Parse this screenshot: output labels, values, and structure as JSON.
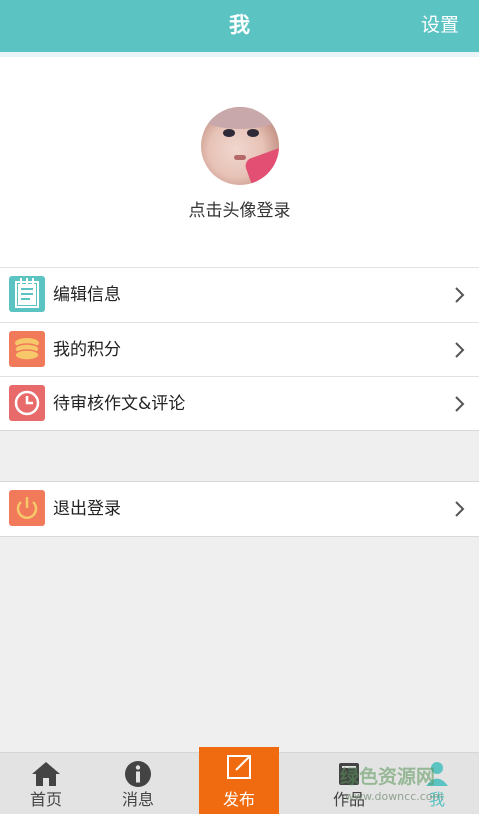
{
  "header": {
    "title": "我",
    "settings_label": "设置"
  },
  "profile": {
    "login_hint": "点击头像登录"
  },
  "menu": {
    "items": [
      {
        "label": "编辑信息",
        "icon": "edit-note-icon",
        "color": "#5cc3c3"
      },
      {
        "label": "我的积分",
        "icon": "coins-icon",
        "color": "#f07a5a"
      },
      {
        "label": "待审核作文&评论",
        "icon": "clock-icon",
        "color": "#e86a6a"
      }
    ],
    "logout": {
      "label": "退出登录",
      "icon": "power-icon",
      "color": "#f07a5a"
    }
  },
  "tabbar": {
    "tabs": [
      {
        "label": "首页",
        "icon": "home-icon"
      },
      {
        "label": "消息",
        "icon": "info-icon"
      },
      {
        "label": "发布",
        "icon": "compose-icon",
        "active_color": "#f06a0f"
      },
      {
        "label": "作品",
        "icon": "book-icon"
      },
      {
        "label": "我",
        "icon": "user-icon",
        "selected": true
      }
    ]
  },
  "watermark": {
    "text": "绿色资源网",
    "url": "www.downcc.com"
  },
  "colors": {
    "accent": "#5cc3c3",
    "publish": "#f06a0f"
  }
}
